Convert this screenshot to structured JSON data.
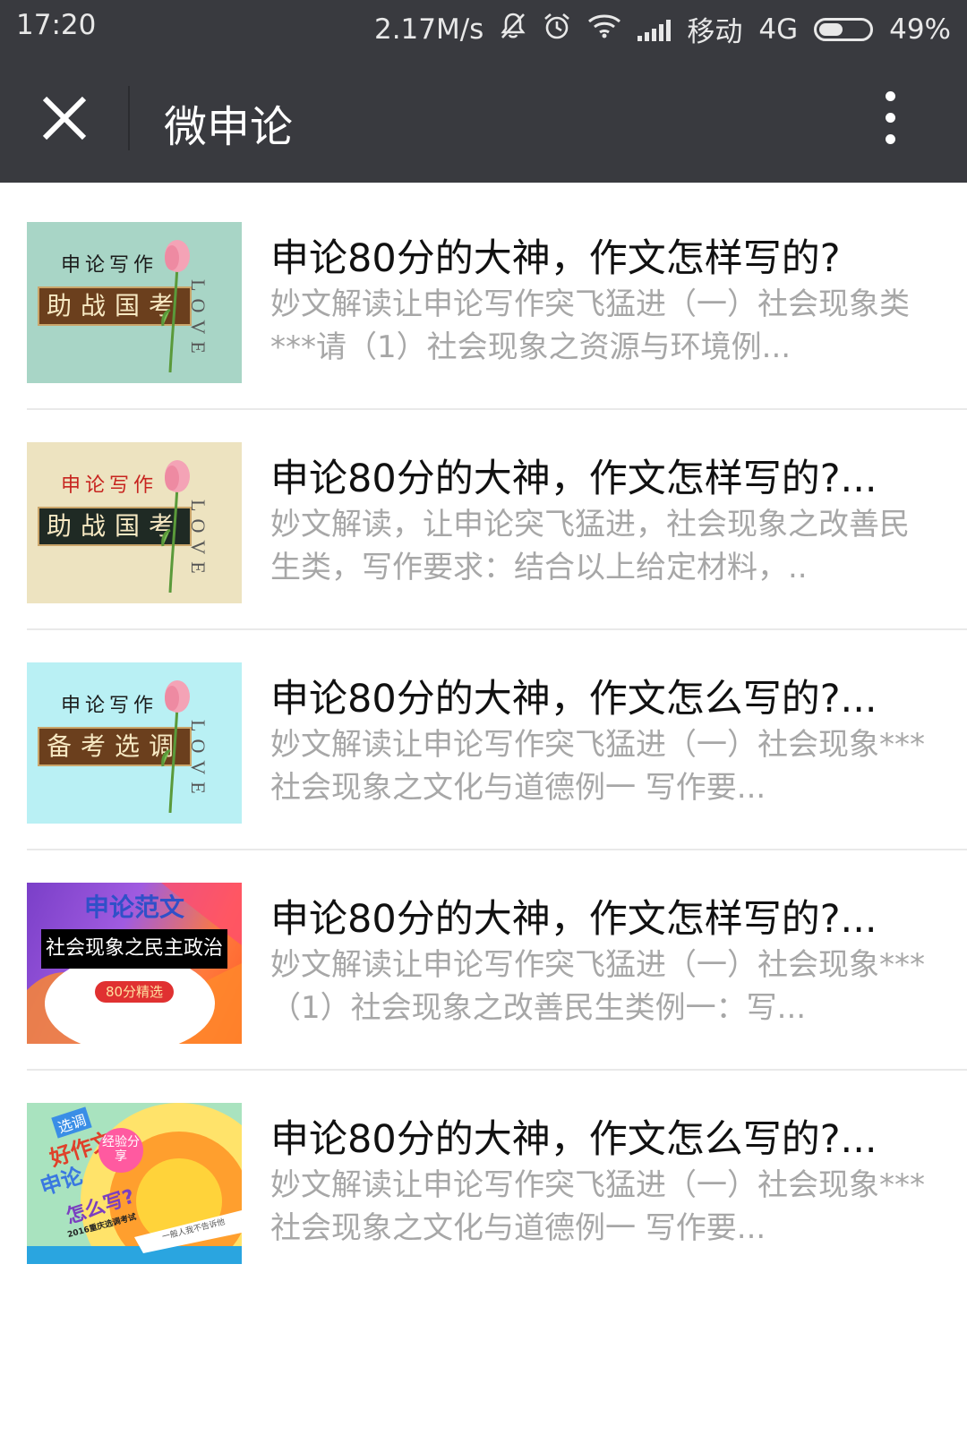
{
  "status_bar": {
    "time": "17:20",
    "speed": "2.17M/s",
    "carrier": "移动",
    "network": "4G",
    "battery_label": "49%",
    "battery_level": 0.49,
    "icons": [
      "mute-icon",
      "alarm-icon",
      "wifi-icon",
      "signal-icon",
      "battery-icon"
    ]
  },
  "app_bar": {
    "title": "微申论",
    "close_icon": "close-icon",
    "more_icon": "more-vertical-icon"
  },
  "articles": [
    {
      "title": "申论80分的大神，作文怎样写的?",
      "desc": "妙文解读让申论写作突飞猛进（一）社会现象类***请（1）社会现象之资源与环境例...",
      "thumb": {
        "small": "申论写作",
        "box": "助战国考",
        "word": "LOVE",
        "bg": "#a8d5c6",
        "box_bg": "#6b3f1d"
      }
    },
    {
      "title": "申论80分的大神，作文怎样写的?...",
      "desc": "妙文解读，让申论突飞猛进，社会现象之改善民生类，写作要求：结合以上给定材料，..",
      "thumb": {
        "small": "申论写作",
        "box": "助战国考",
        "word": "LOVE",
        "bg": "#ede3c0",
        "box_bg": "#1f2a24"
      }
    },
    {
      "title": "申论80分的大神，作文怎么写的?...",
      "desc": "妙文解读让申论写作突飞猛进（一）社会现象***社会现象之文化与道德例一 写作要...",
      "thumb": {
        "small": "申论写作",
        "box": "备考选调",
        "word": "LOVE",
        "bg": "#b9f0f4",
        "box_bg": "#6b3f1d"
      }
    },
    {
      "title": "申论80分的大神，作文怎样写的?...",
      "desc": "妙文解读让申论写作突飞猛进（一）社会现象***（1）社会现象之改善民生类例一：写...",
      "thumb": {
        "heading": "申论范文",
        "banner": "社会现象之民主政治",
        "badge": "80分精选"
      }
    },
    {
      "title": "申论80分的大神，作文怎么写的?...",
      "desc": "妙文解读让申论写作突飞猛进（一）社会现象***社会现象之文化与道德例一 写作要...",
      "thumb": {
        "tag": "选调",
        "line1": "好作文",
        "line2": "申论",
        "line3": "怎么写?",
        "bubble": "经验分享",
        "year": "2016重庆选调考试",
        "ribbon": "一般人我不告诉他"
      }
    }
  ]
}
